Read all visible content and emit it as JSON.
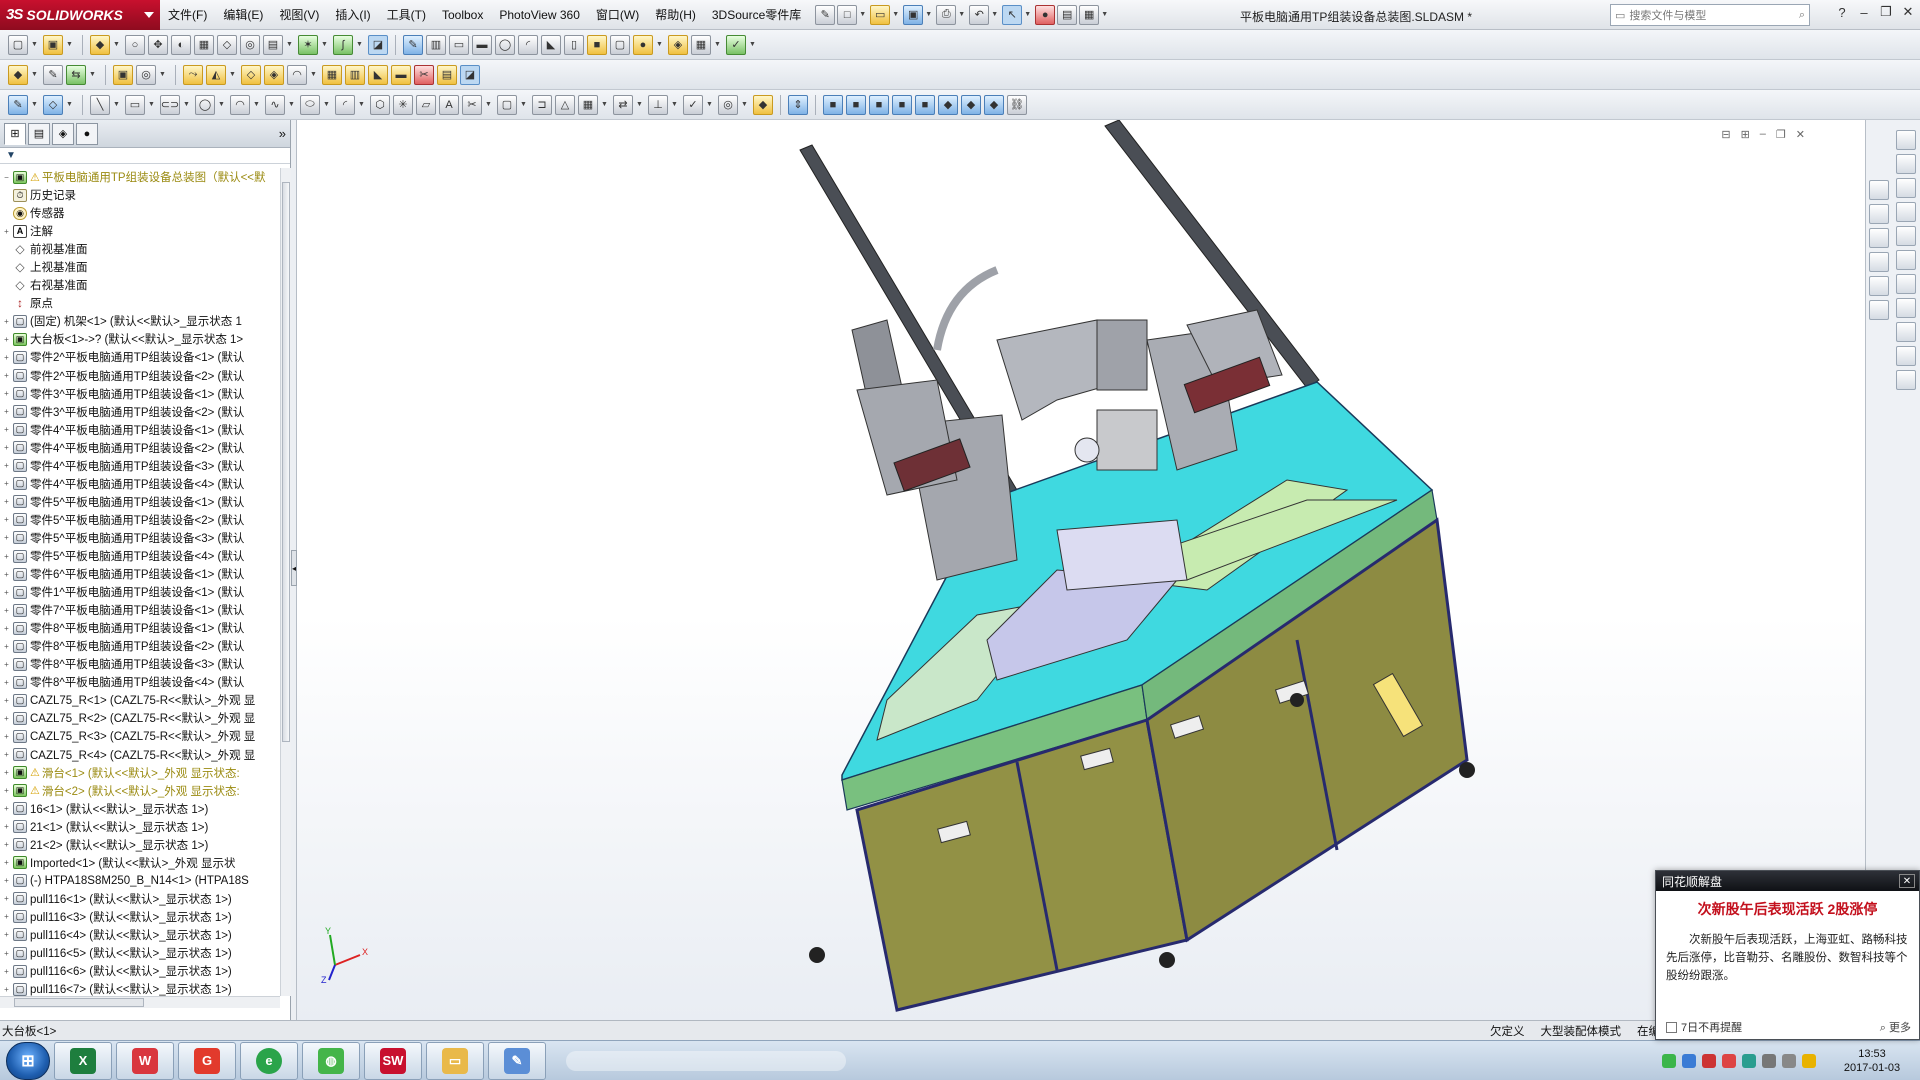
{
  "app": {
    "logo_text": "SOLIDWORKS",
    "menus": [
      "文件(F)",
      "编辑(E)",
      "视图(V)",
      "插入(I)",
      "工具(T)",
      "Toolbox",
      "PhotoView 360",
      "窗口(W)",
      "帮助(H)",
      "3DSource零件库"
    ],
    "document_title": "平板电脑通用TP组装设备总装图.SLDASM *",
    "search_placeholder": "搜索文件与模型",
    "help_label": "?"
  },
  "feature_tree": {
    "rows": [
      {
        "icon": "asm",
        "text": "平板电脑通用TP组装设备总装图（默认<<默",
        "warn": true,
        "exp": "−"
      },
      {
        "icon": "hist",
        "text": "历史记录",
        "warn": false,
        "exp": ""
      },
      {
        "icon": "sens",
        "text": "传感器",
        "warn": false,
        "exp": ""
      },
      {
        "icon": "note",
        "text": "注解",
        "warn": false,
        "exp": "+"
      },
      {
        "icon": "plane",
        "text": "前视基准面",
        "warn": false,
        "exp": ""
      },
      {
        "icon": "plane",
        "text": "上视基准面",
        "warn": false,
        "exp": ""
      },
      {
        "icon": "plane",
        "text": "右视基准面",
        "warn": false,
        "exp": ""
      },
      {
        "icon": "orig",
        "text": "原点",
        "warn": false,
        "exp": ""
      },
      {
        "icon": "part",
        "text": "(固定) 机架<1> (默认<<默认>_显示状态 1",
        "warn": false,
        "exp": "+"
      },
      {
        "icon": "asm",
        "text": "大台板<1>->? (默认<<默认>_显示状态 1>",
        "warn": false,
        "exp": "+"
      },
      {
        "icon": "part",
        "text": "零件2^平板电脑通用TP组装设备<1> (默认",
        "warn": false,
        "exp": "+"
      },
      {
        "icon": "part",
        "text": "零件2^平板电脑通用TP组装设备<2> (默认",
        "warn": false,
        "exp": "+"
      },
      {
        "icon": "part",
        "text": "零件3^平板电脑通用TP组装设备<1> (默认",
        "warn": false,
        "exp": "+"
      },
      {
        "icon": "part",
        "text": "零件3^平板电脑通用TP组装设备<2> (默认",
        "warn": false,
        "exp": "+"
      },
      {
        "icon": "part",
        "text": "零件4^平板电脑通用TP组装设备<1> (默认",
        "warn": false,
        "exp": "+"
      },
      {
        "icon": "part",
        "text": "零件4^平板电脑通用TP组装设备<2> (默认",
        "warn": false,
        "exp": "+"
      },
      {
        "icon": "part",
        "text": "零件4^平板电脑通用TP组装设备<3> (默认",
        "warn": false,
        "exp": "+"
      },
      {
        "icon": "part",
        "text": "零件4^平板电脑通用TP组装设备<4> (默认",
        "warn": false,
        "exp": "+"
      },
      {
        "icon": "part",
        "text": "零件5^平板电脑通用TP组装设备<1> (默认",
        "warn": false,
        "exp": "+"
      },
      {
        "icon": "part",
        "text": "零件5^平板电脑通用TP组装设备<2> (默认",
        "warn": false,
        "exp": "+"
      },
      {
        "icon": "part",
        "text": "零件5^平板电脑通用TP组装设备<3> (默认",
        "warn": false,
        "exp": "+"
      },
      {
        "icon": "part",
        "text": "零件5^平板电脑通用TP组装设备<4> (默认",
        "warn": false,
        "exp": "+"
      },
      {
        "icon": "part",
        "text": "零件6^平板电脑通用TP组装设备<1> (默认",
        "warn": false,
        "exp": "+"
      },
      {
        "icon": "part",
        "text": "零件1^平板电脑通用TP组装设备<1> (默认",
        "warn": false,
        "exp": "+"
      },
      {
        "icon": "part",
        "text": "零件7^平板电脑通用TP组装设备<1> (默认",
        "warn": false,
        "exp": "+"
      },
      {
        "icon": "part",
        "text": "零件8^平板电脑通用TP组装设备<1> (默认",
        "warn": false,
        "exp": "+"
      },
      {
        "icon": "part",
        "text": "零件8^平板电脑通用TP组装设备<2> (默认",
        "warn": false,
        "exp": "+"
      },
      {
        "icon": "part",
        "text": "零件8^平板电脑通用TP组装设备<3> (默认",
        "warn": false,
        "exp": "+"
      },
      {
        "icon": "part",
        "text": "零件8^平板电脑通用TP组装设备<4> (默认",
        "warn": false,
        "exp": "+"
      },
      {
        "icon": "part",
        "text": "CAZL75_R<1> (CAZL75-R<<默认>_外观 显",
        "warn": false,
        "exp": "+"
      },
      {
        "icon": "part",
        "text": "CAZL75_R<2> (CAZL75-R<<默认>_外观 显",
        "warn": false,
        "exp": "+"
      },
      {
        "icon": "part",
        "text": "CAZL75_R<3> (CAZL75-R<<默认>_外观 显",
        "warn": false,
        "exp": "+"
      },
      {
        "icon": "part",
        "text": "CAZL75_R<4> (CAZL75-R<<默认>_外观 显",
        "warn": false,
        "exp": "+"
      },
      {
        "icon": "asm",
        "text": "滑台<1> (默认<<默认>_外观 显示状态:",
        "warn": true,
        "exp": "+"
      },
      {
        "icon": "asm",
        "text": "滑台<2> (默认<<默认>_外观 显示状态:",
        "warn": true,
        "exp": "+"
      },
      {
        "icon": "part",
        "text": "16<1> (默认<<默认>_显示状态 1>)",
        "warn": false,
        "exp": "+"
      },
      {
        "icon": "part",
        "text": "21<1> (默认<<默认>_显示状态 1>)",
        "warn": false,
        "exp": "+"
      },
      {
        "icon": "part",
        "text": "21<2> (默认<<默认>_显示状态 1>)",
        "warn": false,
        "exp": "+"
      },
      {
        "icon": "asm",
        "text": "Imported<1> (默认<<默认>_外观 显示状",
        "warn": false,
        "exp": "+"
      },
      {
        "icon": "part",
        "text": "(-) HTPA18S8M250_B_N14<1> (HTPA18S",
        "warn": false,
        "exp": "+"
      },
      {
        "icon": "part",
        "text": "pull116<1> (默认<<默认>_显示状态 1>)",
        "warn": false,
        "exp": "+"
      },
      {
        "icon": "part",
        "text": "pull116<3> (默认<<默认>_显示状态 1>)",
        "warn": false,
        "exp": "+"
      },
      {
        "icon": "part",
        "text": "pull116<4> (默认<<默认>_显示状态 1>)",
        "warn": false,
        "exp": "+"
      },
      {
        "icon": "part",
        "text": "pull116<5> (默认<<默认>_显示状态 1>)",
        "warn": false,
        "exp": "+"
      },
      {
        "icon": "part",
        "text": "pull116<6> (默认<<默认>_显示状态 1>)",
        "warn": false,
        "exp": "+"
      },
      {
        "icon": "part",
        "text": "pull116<7> (默认<<默认>_显示状态 1>)",
        "warn": false,
        "exp": "+"
      }
    ]
  },
  "statusbar": {
    "selection": "大台板<1>",
    "state": "欠定义",
    "mode": "大型装配体模式",
    "edit": "在编辑"
  },
  "popup": {
    "header": "同花顺解盘",
    "title": "次新股午后表现活跃 2股涨停",
    "body": "次新股午后表现活跃，上海亚虹、路畅科技先后涨停，比音勒芬、名雕股份、数智科技等个股纷纷跟涨。",
    "checkbox_label": "7日不再提醒",
    "more_label": "更多"
  },
  "taskbar": {
    "apps": [
      "excel",
      "wps",
      "g",
      "ie",
      "wechat",
      "solidworks",
      "explorer",
      "paint"
    ],
    "clock_time": "13:53",
    "clock_date": "2017-01-03"
  },
  "triad": {
    "x": "X",
    "y": "Y",
    "z": "Z"
  }
}
